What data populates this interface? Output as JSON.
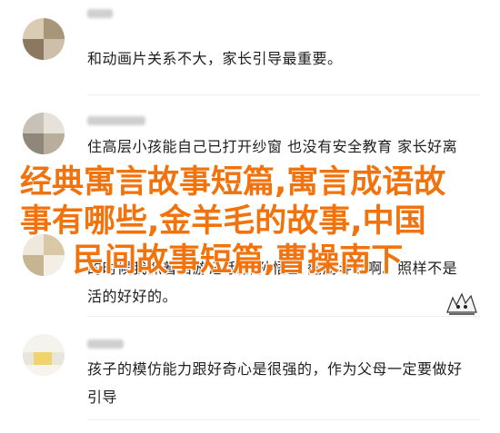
{
  "comments": [
    {
      "text": "和动画片关系不大，家长引导最重要。"
    },
    {
      "text": "住高层小孩能自己已打开纱窗 也没有安全教育 家长好离谱"
    },
    {
      "text": "的时候我抓着西游记 我抓孙悟空  翻筋斗云啊。照样不是活的好好的。"
    },
    {
      "text": "孩子的模仿能力跟好奇心是很强的，作为父母一定要做好引导"
    }
  ],
  "overlay": {
    "line1": "经典寓言故事短篇,寓言成语故",
    "line2": "事有哪些,金羊毛的故事,中国",
    "line3": "民间故事短篇,曹操南下"
  },
  "colors": {
    "overlay_text": "#f2720c",
    "divider": "#ededed"
  },
  "icons": {
    "sticker": "cartoon-sticker-icon"
  }
}
